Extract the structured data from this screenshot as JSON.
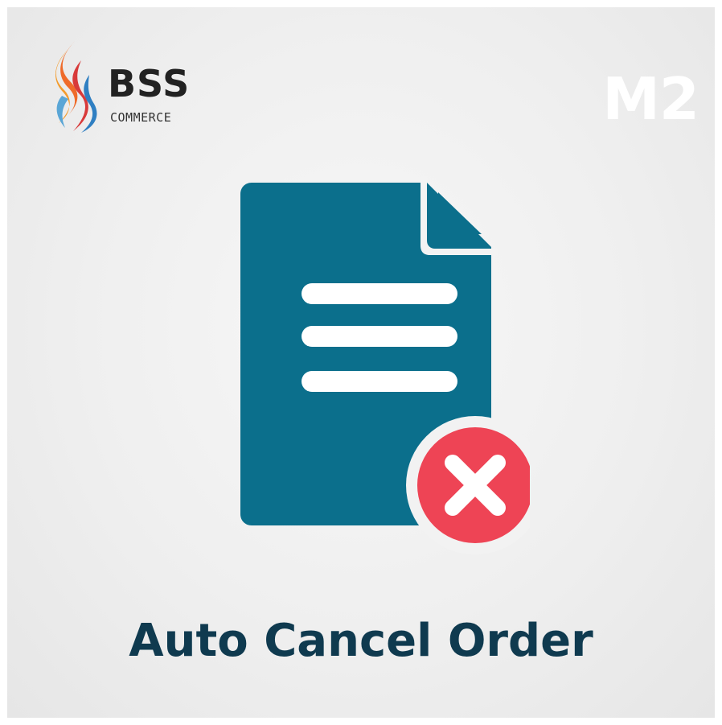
{
  "brand": {
    "name": "BSS",
    "sub": "COMMERCE",
    "logo_icon": "flame-logo-icon"
  },
  "badge": "M2",
  "illustration": {
    "icon": "document-icon",
    "cancel_icon": "cancel-x-icon",
    "colors": {
      "document": "#0b6f8c",
      "cancel": "#ee4455",
      "lines": "#ffffff"
    }
  },
  "title": "Auto Cancel Order"
}
